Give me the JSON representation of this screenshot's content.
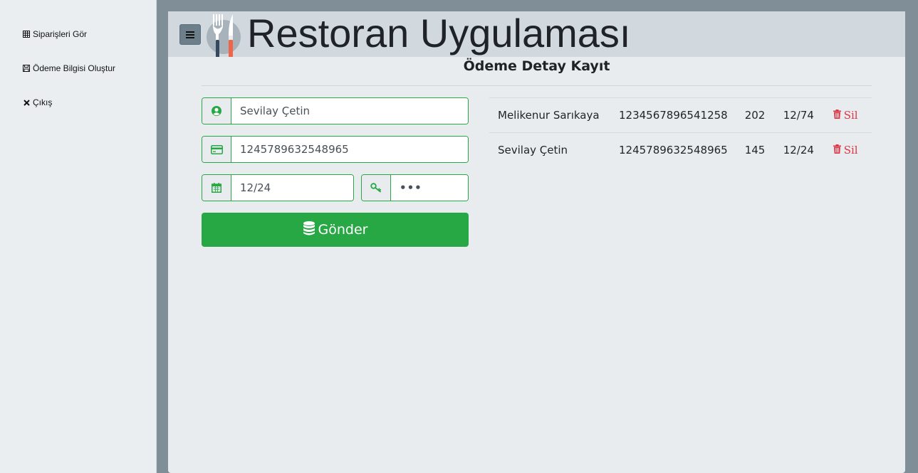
{
  "sidebar": {
    "items": [
      {
        "label": "Siparişleri Gör",
        "icon": "table-icon"
      },
      {
        "label": "Ödeme Bilgisi Oluştur",
        "icon": "save-icon"
      },
      {
        "label": "Çıkış",
        "icon": "close-icon"
      }
    ]
  },
  "header": {
    "title": "Restoran Uygulaması",
    "menu_icon": "hamburger-icon",
    "logo_icon": "fork-knife-icon"
  },
  "page": {
    "title": "Ödeme Detay Kayıt"
  },
  "form": {
    "name_value": "Sevilay Çetin",
    "card_value": "1245789632548965",
    "expiry_value": "12/24",
    "cvv_value": "•••",
    "submit_label": "Gönder"
  },
  "table": {
    "rows": [
      {
        "name": "Melikenur Sarıkaya",
        "card": "1234567896541258",
        "cvv": "202",
        "expiry": "12/74",
        "action": "Sil"
      },
      {
        "name": "Sevilay Çetin",
        "card": "1245789632548965",
        "cvv": "145",
        "expiry": "12/24",
        "action": "Sil"
      }
    ]
  },
  "colors": {
    "accent_green": "#28a745",
    "danger_red": "#dc3545",
    "frame_gray": "#808f97",
    "header_bg": "#d1d8de"
  }
}
